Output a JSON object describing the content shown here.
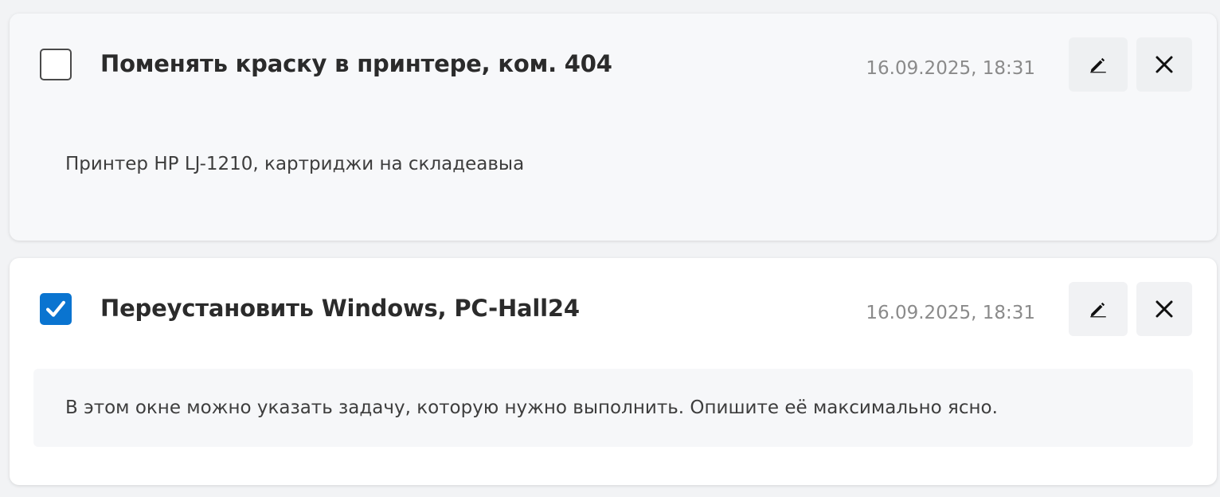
{
  "tasks": [
    {
      "title": "Поменять краску в принтере, ком. 404",
      "date": "16.09.2025, 18:31",
      "description": "Принтер HP LJ-1210, картриджи на складеавыа",
      "checked": false
    },
    {
      "title": "Переустановить Windows, PC-Hall24",
      "date": "16.09.2025, 18:31",
      "description": "В этом окне можно указать задачу, которую нужно выполнить. Опишите её максимально ясно.",
      "checked": true
    }
  ],
  "icons": {
    "edit": "pencil-icon",
    "delete": "close-icon",
    "check": "checkmark-icon"
  },
  "colors": {
    "accent": "#0a74d0",
    "date_text": "#8a8a8a",
    "title_text": "#2b2b2b"
  }
}
